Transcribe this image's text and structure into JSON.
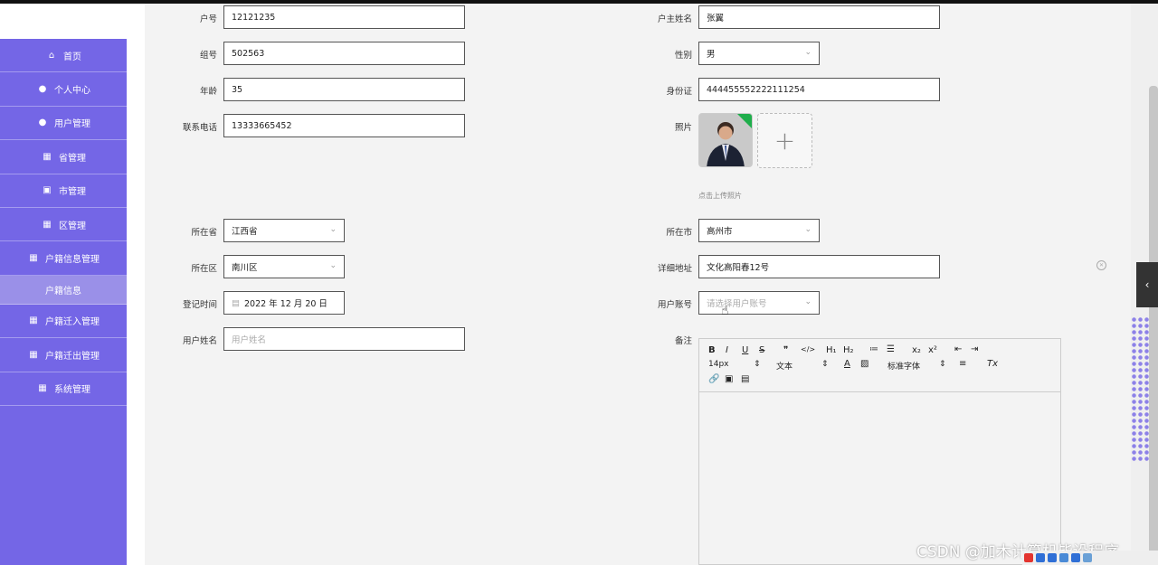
{
  "sidebar": {
    "items": [
      {
        "label": "首页",
        "icon": "home-icon",
        "glyph": "⌂"
      },
      {
        "label": "个人中心",
        "icon": "user-icon",
        "glyph": "●"
      },
      {
        "label": "用户管理",
        "icon": "user-manage-icon",
        "glyph": "●"
      },
      {
        "label": "省管理",
        "icon": "grid-icon",
        "glyph": "▦"
      },
      {
        "label": "市管理",
        "icon": "clipboard-icon",
        "glyph": "▣"
      },
      {
        "label": "区管理",
        "icon": "grid-icon",
        "glyph": "▦"
      },
      {
        "label": "户籍信息管理",
        "icon": "table-icon",
        "glyph": "▦"
      },
      {
        "label": "户籍信息",
        "icon": "",
        "glyph": ""
      },
      {
        "label": "户籍迁入管理",
        "icon": "grid-icon",
        "glyph": "▦"
      },
      {
        "label": "户籍迁出管理",
        "icon": "grid-icon",
        "glyph": "▦"
      },
      {
        "label": "系统管理",
        "icon": "grid-icon",
        "glyph": "▦"
      }
    ]
  },
  "form": {
    "huhao": {
      "label": "户号",
      "value": "12121235"
    },
    "huzhu": {
      "label": "户主姓名",
      "value": "张翼"
    },
    "zuhao": {
      "label": "组号",
      "value": "502563"
    },
    "xingbie": {
      "label": "性别",
      "value": "男"
    },
    "nianling": {
      "label": "年龄",
      "value": "35"
    },
    "shenfenzheng": {
      "label": "身份证",
      "value": "444455552222111254"
    },
    "dianhua": {
      "label": "联系电话",
      "value": "13333665452"
    },
    "zhaopian": {
      "label": "照片",
      "hint": "点击上传照片",
      "add": "+"
    },
    "sheng": {
      "label": "所在省",
      "value": "江西省"
    },
    "shi": {
      "label": "所在市",
      "value": "高州市"
    },
    "qu": {
      "label": "所在区",
      "value": "南川区"
    },
    "dizhi": {
      "label": "详细地址",
      "value": "文化高阳春12号"
    },
    "dengji": {
      "label": "登记时间",
      "value": "2022 年 12 月 20 日"
    },
    "zhanghao": {
      "label": "用户账号",
      "placeholder": "请选择用户账号"
    },
    "xingming": {
      "label": "用户姓名",
      "placeholder": "用户姓名"
    },
    "beizhu": {
      "label": "备注"
    }
  },
  "editor": {
    "row1": [
      "B",
      "I",
      "U",
      "S",
      "❞",
      "</>",
      "H₁",
      "H₂",
      "≔",
      "☰",
      "x₂",
      "x²",
      "⇤",
      "⇥"
    ],
    "fontsize": "14px",
    "format": "文本",
    "font": "标准字体",
    "clear": "Tx"
  },
  "misc": {
    "watermark": "CSDN @加木计算机毕设程序",
    "side_tab": "‹",
    "accent": "#7466e6"
  }
}
